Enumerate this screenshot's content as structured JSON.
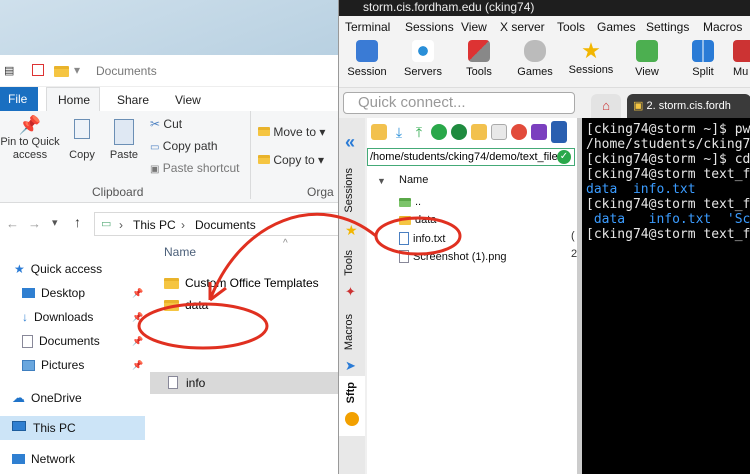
{
  "explorer": {
    "title": "Documents",
    "tabs": [
      "File",
      "Home",
      "Share",
      "View"
    ],
    "ribbon": {
      "pin_label": "Pin to Quick access",
      "copy_label": "Copy",
      "paste_label": "Paste",
      "cut_label": "Cut",
      "copy_path_label": "Copy path",
      "paste_shortcut_label": "Paste shortcut",
      "clipboard_group": "Clipboard",
      "move_to_label": "Move to",
      "copy_to_label": "Copy to",
      "organize_group": "Orga"
    },
    "breadcrumb": [
      "This PC",
      "Documents"
    ],
    "column_name": "Name",
    "nav": {
      "quick_access": "Quick access",
      "items": [
        "Desktop",
        "Downloads",
        "Documents",
        "Pictures"
      ],
      "onedrive": "OneDrive",
      "this_pc": "This PC",
      "network": "Network"
    },
    "files": [
      "Custom Office Templates",
      "data",
      "info"
    ]
  },
  "moba": {
    "title": "storm.cis.fordham.edu (cking74)",
    "menu": [
      "Terminal",
      "Sessions",
      "View",
      "X server",
      "Tools",
      "Games",
      "Settings",
      "Macros"
    ],
    "toolbar": [
      "Session",
      "Servers",
      "Tools",
      "Games",
      "Sessions",
      "View",
      "Split",
      "Mu"
    ],
    "quick_connect_placeholder": "Quick connect...",
    "session_tab": "2. storm.cis.fordh",
    "side_labels": [
      "Sessions",
      "Tools",
      "Macros",
      "Sftp"
    ],
    "sftp_path": "/home/students/cking74/demo/text_file",
    "sftp_column": "Name",
    "sftp_files": [
      "..",
      "data",
      "info.txt",
      "Screenshot (1).png"
    ],
    "terminal_lines": [
      "[cking74@storm ~]$ pw",
      "/home/students/cking7",
      "[cking74@storm ~]$ cd",
      "[cking74@storm text_f",
      "data  info.txt",
      "[cking74@storm text_f",
      " data   info.txt  'Sc",
      "[cking74@storm text_f"
    ],
    "colors": {
      "terminal_bg": "#000000",
      "highlight_line": "#3b9cff",
      "annotation": "#e03020"
    }
  }
}
